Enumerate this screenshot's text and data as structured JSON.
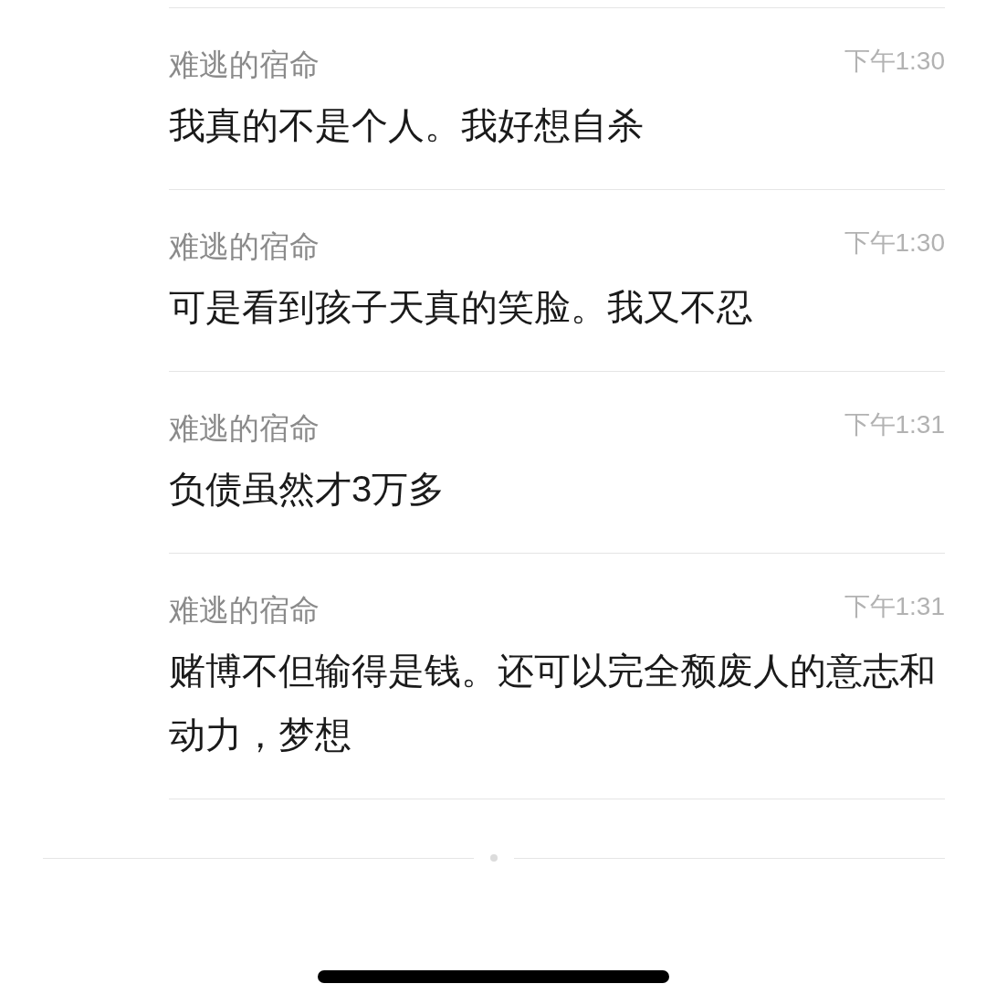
{
  "messages": [
    {
      "sender": "难逃的宿命",
      "time": "下午1:30",
      "text": "我真的不是个人。我好想自杀"
    },
    {
      "sender": "难逃的宿命",
      "time": "下午1:30",
      "text": "可是看到孩子天真的笑脸。我又不忍"
    },
    {
      "sender": "难逃的宿命",
      "time": "下午1:31",
      "text": "负债虽然才3万多"
    },
    {
      "sender": "难逃的宿命",
      "time": "下午1:31",
      "text": "赌博不但输得是钱。还可以完全颓废人的意志和动力，梦想"
    }
  ]
}
